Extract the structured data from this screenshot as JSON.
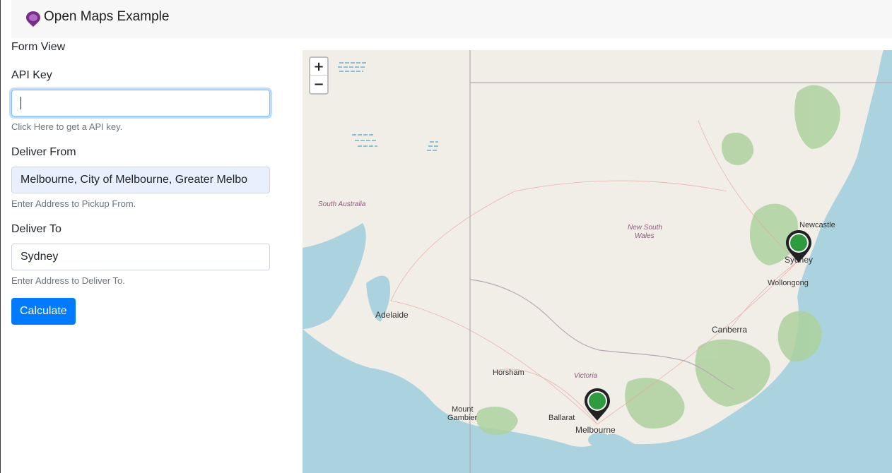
{
  "app": {
    "title": "Open Maps Example"
  },
  "form": {
    "view_title": "Form View",
    "api_key": {
      "label": "API Key",
      "value": "",
      "help": "Click Here to get a API key."
    },
    "deliver_from": {
      "label": "Deliver From",
      "value": "Melbourne, City of Melbourne, Greater Melbo",
      "help": "Enter Address to Pickup From."
    },
    "deliver_to": {
      "label": "Deliver To",
      "value": "Sydney",
      "help": "Enter Address to Deliver To."
    },
    "calculate_label": "Calculate"
  },
  "map": {
    "zoom_in": "+",
    "zoom_out": "−",
    "labels": {
      "south_australia": "South Australia",
      "nsw_line1": "New South",
      "nsw_line2": "Wales",
      "victoria": "Victoria",
      "adelaide": "Adelaide",
      "horsham": "Horsham",
      "mount_gambier_1": "Mount",
      "mount_gambier_2": "Gambier",
      "ballarat": "Ballarat",
      "melbourne": "Melbourne",
      "canberra": "Canberra",
      "wollongong": "Wollongong",
      "sydney": "Sydney",
      "newcastle": "Newcastle"
    },
    "icons": {
      "brand": "map-pin-icon",
      "marker": "location-marker-icon"
    },
    "colors": {
      "marker": "#2e9b3f",
      "button": "#007bff",
      "water": "#aad3df",
      "land": "#f1eee8"
    }
  }
}
